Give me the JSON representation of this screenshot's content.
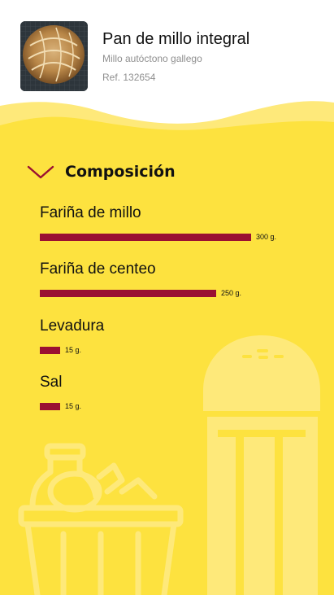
{
  "product": {
    "title": "Pan de millo integral",
    "subtitle": "Millo autóctono gallego",
    "ref": "Ref. 132654",
    "image_icon": "bread-photo"
  },
  "composition": {
    "title": "Composición",
    "toggle_icon": "chevron-down-icon",
    "max_value": 300,
    "items": [
      {
        "label": "Fariña de millo",
        "value": 300,
        "value_label": "300 g."
      },
      {
        "label": "Fariña de centeo",
        "value": 250,
        "value_label": "250 g."
      },
      {
        "label": "Levadura",
        "value": 15,
        "value_label": "15 g."
      },
      {
        "label": "Sal",
        "value": 15,
        "value_label": "15 g."
      }
    ]
  },
  "colors": {
    "background": "#fde23f",
    "bar": "#9a1032",
    "chevron": "#9a1032",
    "decor": "#fee97a"
  }
}
